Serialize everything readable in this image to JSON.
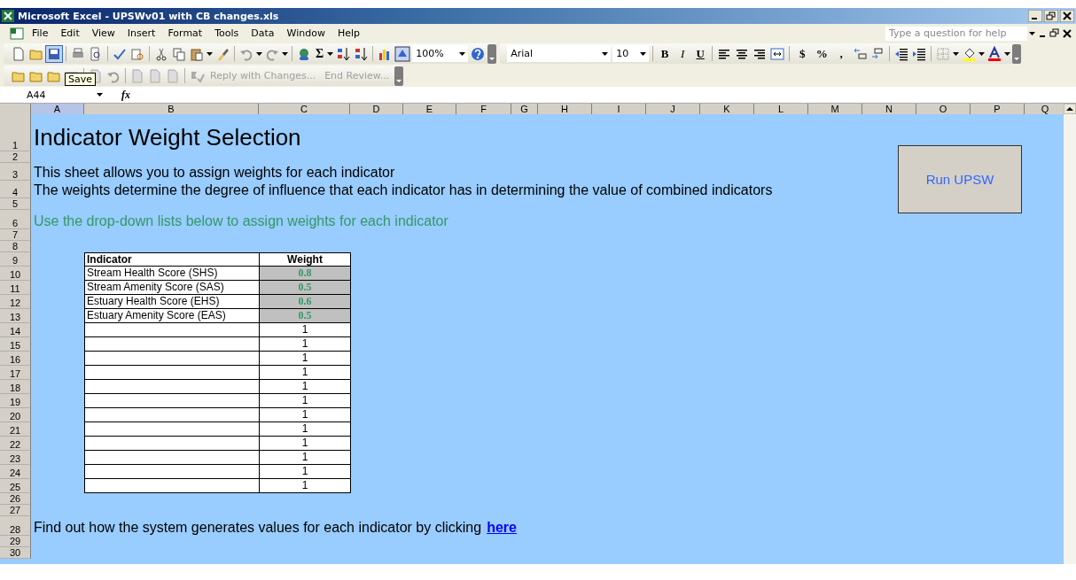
{
  "window": {
    "title": "Microsoft Excel - UPSWv01 with CB changes.xls"
  },
  "menu": [
    {
      "label": "File"
    },
    {
      "label": "Edit"
    },
    {
      "label": "View"
    },
    {
      "label": "Insert"
    },
    {
      "label": "Format"
    },
    {
      "label": "Tools"
    },
    {
      "label": "Data"
    },
    {
      "label": "Window"
    },
    {
      "label": "Help"
    }
  ],
  "help_search": {
    "placeholder": "Type a question for help"
  },
  "standard_toolbar": {
    "sum_symbol": "Σ",
    "zoom": "100%"
  },
  "formatting_toolbar": {
    "font": "Arial",
    "size": "10",
    "style_buttons": [
      {
        "label": "B",
        "kind": "bold"
      },
      {
        "label": "I",
        "kind": "italic"
      },
      {
        "label": "U",
        "kind": "underline"
      }
    ],
    "number_buttons": [
      "$",
      "%",
      ","
    ]
  },
  "reviewing_toolbar": {
    "buttons": [
      {
        "label": "Reply with Changes...",
        "disabled": true
      },
      {
        "label": "End Review...",
        "disabled": true
      }
    ]
  },
  "tooltip": "Save",
  "formula_bar": {
    "name_box": "A44",
    "fx": "fx"
  },
  "columns": [
    {
      "label": "A",
      "selected": true
    },
    {
      "label": "B",
      "selected": false
    },
    {
      "label": "C",
      "selected": false
    },
    {
      "label": "D",
      "selected": false
    },
    {
      "label": "E",
      "selected": false
    },
    {
      "label": "F",
      "selected": false
    },
    {
      "label": "G",
      "selected": false
    },
    {
      "label": "H",
      "selected": false
    },
    {
      "label": "I",
      "selected": false
    },
    {
      "label": "J",
      "selected": false
    },
    {
      "label": "K",
      "selected": false
    },
    {
      "label": "L",
      "selected": false
    },
    {
      "label": "M",
      "selected": false
    },
    {
      "label": "N",
      "selected": false
    },
    {
      "label": "O",
      "selected": false
    },
    {
      "label": "P",
      "selected": false
    },
    {
      "label": "Q",
      "selected": false
    }
  ],
  "rows": [
    {
      "number": "1",
      "kind": "title",
      "text": "Indicator Weight Selection"
    },
    {
      "number": "2",
      "kind": "blank"
    },
    {
      "number": "3",
      "kind": "text",
      "text": "This sheet allows you to assign weights for each indicator"
    },
    {
      "number": "4",
      "kind": "text",
      "text": "The weights determine the degree of influence that each indicator has in determining the value of combined indicators"
    },
    {
      "number": "5",
      "kind": "blank"
    },
    {
      "number": "6",
      "kind": "note",
      "text": "Use the drop-down lists below to assign weights for each indicator"
    },
    {
      "number": "7",
      "kind": "blank"
    },
    {
      "number": "8",
      "kind": "blank"
    },
    {
      "number": "9",
      "kind": "table_header",
      "cells": [
        {
          "text": "Indicator"
        },
        {
          "text": "Weight"
        }
      ]
    },
    {
      "number": "10",
      "kind": "table",
      "cells": [
        {
          "text": "Stream Health Score (SHS)"
        },
        {
          "text": "0.8",
          "dropdown": true
        }
      ]
    },
    {
      "number": "11",
      "kind": "table",
      "cells": [
        {
          "text": "Stream Amenity Score (SAS)"
        },
        {
          "text": "0.5",
          "dropdown": true
        }
      ]
    },
    {
      "number": "12",
      "kind": "table",
      "cells": [
        {
          "text": "Estuary Health Score (EHS)"
        },
        {
          "text": "0.6",
          "dropdown": true
        }
      ]
    },
    {
      "number": "13",
      "kind": "table",
      "cells": [
        {
          "text": "Estuary  Amenity Score (EAS)"
        },
        {
          "text": "0.5",
          "dropdown": true
        }
      ]
    },
    {
      "number": "14",
      "kind": "table",
      "cells": [
        {},
        {
          "text": "1",
          "dropdown": false
        }
      ]
    },
    {
      "number": "15",
      "kind": "table",
      "cells": [
        {},
        {
          "text": "1",
          "dropdown": false
        }
      ]
    },
    {
      "number": "16",
      "kind": "table",
      "cells": [
        {},
        {
          "text": "1",
          "dropdown": false
        }
      ]
    },
    {
      "number": "17",
      "kind": "table",
      "cells": [
        {},
        {
          "text": "1",
          "dropdown": false
        }
      ]
    },
    {
      "number": "18",
      "kind": "table",
      "cells": [
        {},
        {
          "text": "1",
          "dropdown": false
        }
      ]
    },
    {
      "number": "19",
      "kind": "table",
      "cells": [
        {},
        {
          "text": "1",
          "dropdown": false
        }
      ]
    },
    {
      "number": "20",
      "kind": "table",
      "cells": [
        {},
        {
          "text": "1",
          "dropdown": false
        }
      ]
    },
    {
      "number": "21",
      "kind": "table",
      "cells": [
        {},
        {
          "text": "1",
          "dropdown": false
        }
      ]
    },
    {
      "number": "22",
      "kind": "table",
      "cells": [
        {},
        {
          "text": "1",
          "dropdown": false
        }
      ]
    },
    {
      "number": "23",
      "kind": "table",
      "cells": [
        {},
        {
          "text": "1",
          "dropdown": false
        }
      ]
    },
    {
      "number": "24",
      "kind": "table",
      "cells": [
        {},
        {
          "text": "1",
          "dropdown": false
        }
      ]
    },
    {
      "number": "25",
      "kind": "table",
      "cells": [
        {},
        {
          "text": "1",
          "dropdown": false
        }
      ]
    },
    {
      "number": "26",
      "kind": "blank"
    },
    {
      "number": "27",
      "kind": "blank"
    },
    {
      "number": "28",
      "kind": "link",
      "text": "Find out how the system generates values for each indicator by clicking",
      "link": "here"
    },
    {
      "number": "29",
      "kind": "blank"
    },
    {
      "number": "30",
      "kind": "blank"
    }
  ],
  "macro_button": {
    "label": "Run UPSW"
  }
}
